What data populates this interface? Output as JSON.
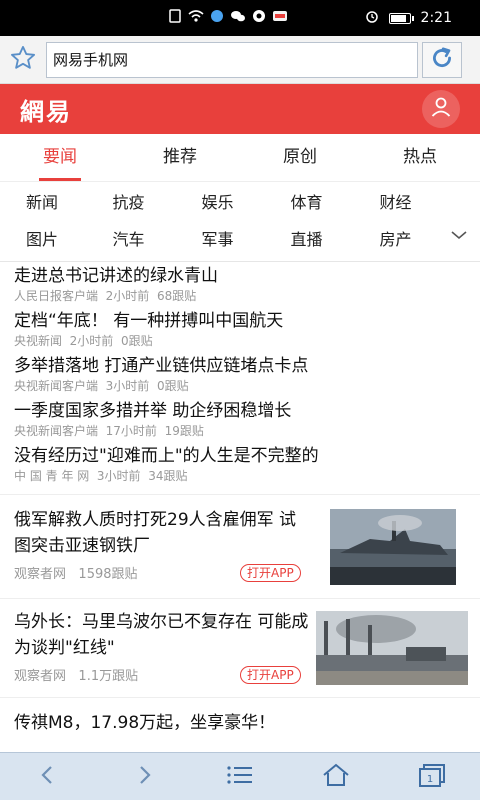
{
  "status_bar": {
    "time": "2:21"
  },
  "browser": {
    "url_text": "网易手机网"
  },
  "header": {
    "logo": "網易"
  },
  "main_tabs": [
    "要闻",
    "推荐",
    "原创",
    "热点"
  ],
  "categories_row1": [
    "新闻",
    "抗疫",
    "娱乐",
    "体育",
    "财经"
  ],
  "categories_row2": [
    "图片",
    "汽车",
    "军事",
    "直播",
    "房产"
  ],
  "news": [
    {
      "title": "走进总书记讲述的绿水青山",
      "source": "人民日报客户端",
      "time": "2小时前",
      "comments": "68跟贴"
    },
    {
      "title": "定档“年底！ 有一种拼搏叫中国航天",
      "source": "央视新闻",
      "time": "2小时前",
      "comments": "0跟贴"
    },
    {
      "title": "多举措落地 打通产业链供应链堵点卡点",
      "source": "央视新闻客户端",
      "time": "3小时前",
      "comments": "0跟贴"
    },
    {
      "title": "一季度国家多措并举 助企纾困稳增长",
      "source": "央视新闻客户端",
      "time": "17小时前",
      "comments": "19跟贴"
    },
    {
      "title": "没有经历过\"迎难而上\"的人生是不完整的",
      "source": "中 国 青 年 网",
      "time": "3小时前",
      "comments": "34跟贴"
    }
  ],
  "image_news": [
    {
      "title": "俄军解救人质时打死29人含雇佣军 试图突击亚速钢铁厂",
      "source": "观察者网",
      "comments": "1598跟贴",
      "button": "打开APP"
    },
    {
      "title": "乌外长：马里乌波尔已不复存在 可能成为谈判\"红线\"",
      "source": "观察者网",
      "comments": "1.1万跟贴",
      "button": "打开APP"
    }
  ],
  "ad": {
    "title": "传祺M8，17.98万起，坐享豪华！"
  },
  "colors": {
    "brand_red": "#e8403c",
    "bottom_bar": "#d9e4f0"
  },
  "icons": [
    "star-icon",
    "refresh-icon",
    "user-icon",
    "chevron-down-icon",
    "back-icon",
    "forward-icon",
    "menu-icon",
    "home-icon",
    "tabs-icon"
  ]
}
